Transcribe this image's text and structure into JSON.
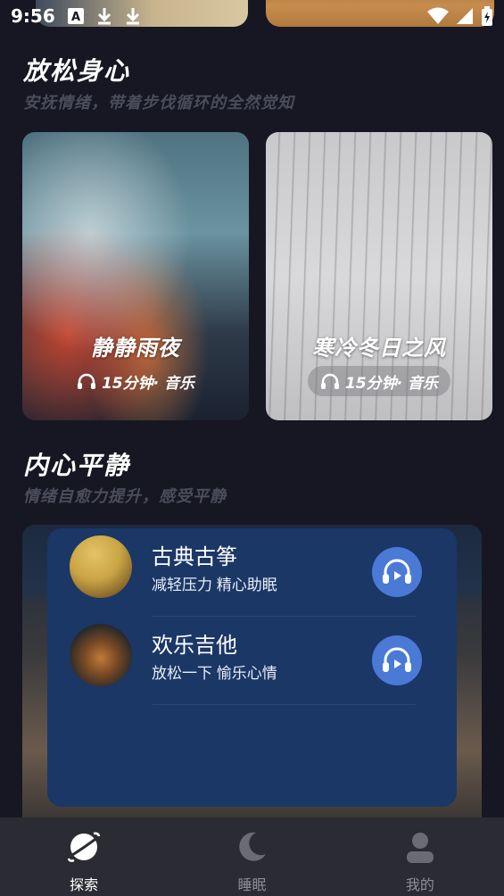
{
  "status_bar": {
    "time": "9:56",
    "left_icons": [
      "font-icon",
      "download-icon",
      "download-icon"
    ],
    "right_icons": [
      "wifi-icon",
      "signal-icon",
      "battery-icon"
    ]
  },
  "section_relax": {
    "title": "放松身心",
    "subtitle": "安抚情绪，带着步伐循环的全然觉知",
    "cards": [
      {
        "title": "静静雨夜",
        "meta": "15分钟· 音乐"
      },
      {
        "title": "寒冷冬日之风",
        "meta": "15分钟· 音乐"
      }
    ]
  },
  "section_calm": {
    "title": "内心平静",
    "subtitle": "情绪自愈力提升，感受平静"
  },
  "popup_list": {
    "items": [
      {
        "name": "古典古筝",
        "desc": "减轻压力  精心助眠"
      },
      {
        "name": "欢乐吉他",
        "desc": "放松一下  愉乐心情"
      }
    ]
  },
  "bottom_nav": {
    "items": [
      {
        "label": "探索",
        "icon": "planet-icon",
        "active": true
      },
      {
        "label": "睡眠",
        "icon": "moon-icon",
        "active": false
      },
      {
        "label": "我的",
        "icon": "user-icon",
        "active": false
      }
    ]
  },
  "colors": {
    "background": "#161722",
    "popup": "#1b3766",
    "play_button": "#4a7ad6",
    "nav_bar": "#2b2c33"
  }
}
